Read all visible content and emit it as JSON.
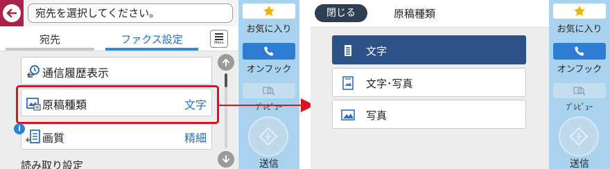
{
  "left_screen": {
    "destination_placeholder": "宛先を選択してください。",
    "tabs": [
      {
        "label": "宛先",
        "active": false
      },
      {
        "label": "ファクス設定",
        "active": true
      }
    ],
    "menu_label": "Menu",
    "rows": [
      {
        "label": "通信履歴表示",
        "value": ""
      },
      {
        "label": "原稿種類",
        "value": "文字"
      },
      {
        "label": "画質",
        "value": "精細"
      }
    ],
    "section_title": "読み取り設定"
  },
  "rail": {
    "favorites_label": "お気に入り",
    "on_hook_label": "オンフック",
    "preview_label": "ﾌﾟﾚﾋﾞｭｰ",
    "send_label": "送信"
  },
  "right_screen": {
    "close_label": "閉じる",
    "title": "原稿種類",
    "options": [
      {
        "label": "文字",
        "selected": true
      },
      {
        "label": "文字･写真",
        "selected": false
      },
      {
        "label": "写真",
        "selected": false
      }
    ]
  },
  "colors": {
    "accent_blue": "#1f6fc9",
    "selected_option": "#2c5288",
    "highlight_red": "#e0101e",
    "rail_blue": "#a9d2ee",
    "back_button": "#a8234a",
    "close_button": "#2d3f54"
  },
  "icons": {
    "back": "arrow-left-icon",
    "star": "star-icon",
    "phone": "phone-icon",
    "preview": "magnifier-icon",
    "send": "diamond-icon",
    "history": "history-icon",
    "original_type": "image-doc-icon",
    "quality": "quality-doc-icon",
    "info": "info-icon"
  }
}
